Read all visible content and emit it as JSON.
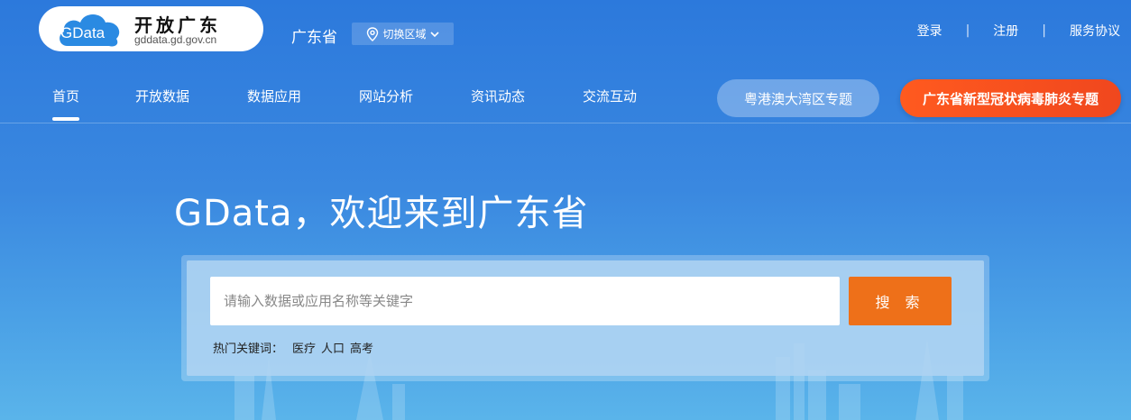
{
  "header": {
    "logo": {
      "badge_text": "GData",
      "title": "开放广东",
      "domain": "gddata.gd.gov.cn"
    },
    "region": {
      "name": "广东省",
      "switch_label": "切换区域"
    },
    "links": [
      {
        "label": "登录"
      },
      {
        "label": "注册"
      },
      {
        "label": "服务协议"
      }
    ],
    "separator": "|"
  },
  "nav": {
    "items": [
      {
        "label": "首页",
        "active": true
      },
      {
        "label": "开放数据"
      },
      {
        "label": "数据应用"
      },
      {
        "label": "网站分析"
      },
      {
        "label": "资讯动态"
      },
      {
        "label": "交流互动"
      }
    ],
    "specials": [
      {
        "label": "粤港澳大湾区专题"
      },
      {
        "label": "广东省新型冠状病毒肺炎专题"
      }
    ]
  },
  "hero": {
    "title": "GData，欢迎来到广东省",
    "search": {
      "placeholder": "请输入数据或应用名称等关键字",
      "value": "",
      "button_label": "搜 索"
    },
    "hot_keywords": {
      "label": "热门关键词：",
      "items": [
        "医疗",
        "人口",
        "高考"
      ]
    }
  },
  "colors": {
    "background_top": "#2c79dc",
    "background_bottom": "#5ab4ea",
    "search_button": "#ee7019",
    "covid_pill": "#f0471e",
    "logo_cloud": "#2a8ae2"
  }
}
